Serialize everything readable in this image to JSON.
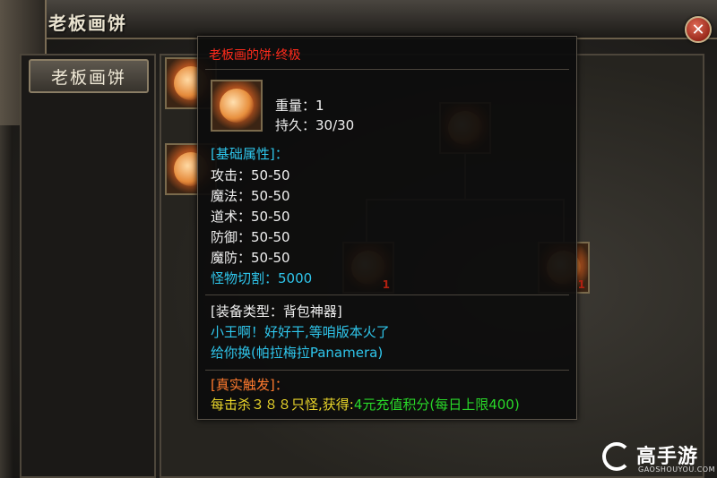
{
  "window": {
    "title": "老板画饼",
    "close_label": "✕"
  },
  "sidebar": {
    "tab_label": "老板画饼"
  },
  "tree": {
    "slot_count": "1"
  },
  "tooltip": {
    "item_name": "老板画的饼·终极",
    "weight_line": "重量：1",
    "durability_line": "持久：30/30",
    "base_attr_header": "[基础属性]：",
    "attrs": [
      "攻击：50-50",
      "魔法：50-50",
      "道术：50-50",
      "防御：50-50",
      "魔防：50-50"
    ],
    "monster_cut": "怪物切割：5000",
    "equip_type": "[装备类型：背包神器]",
    "flavor_line1": "小王啊！好好干,等咱版本火了",
    "flavor_line2": "给你换(帕拉梅拉Panamera)",
    "trigger_header": "[真实触发]：",
    "trigger_prefix": "每击杀３８８只怪,获得:",
    "trigger_reward": "4元充值积分(每日上限400)"
  },
  "watermark": {
    "name": "高手游",
    "url": "GAOSHOUYOU.COM"
  },
  "colors": {
    "item_name": "#ff2b1c",
    "cyan": "#2fc6ec",
    "orange": "#ff7a2e",
    "yellow": "#e8d42a",
    "green": "#29d829"
  }
}
